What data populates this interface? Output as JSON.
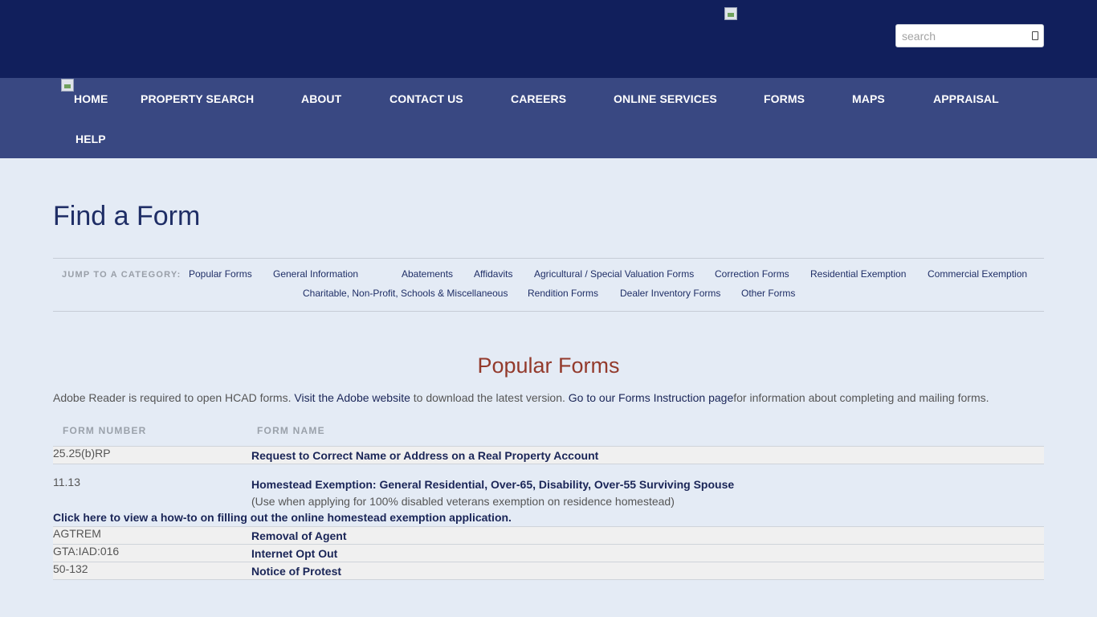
{
  "header": {
    "search_placeholder": "search"
  },
  "nav": {
    "items": [
      "HOME",
      "PROPERTY SEARCH",
      "ABOUT",
      "CONTACT US",
      "CAREERS",
      "ONLINE SERVICES",
      "FORMS",
      "MAPS",
      "APPRAISAL",
      "HELP"
    ]
  },
  "page": {
    "title": "Find a Form"
  },
  "jump": {
    "label": "JUMP TO A CATEGORY:",
    "categories": [
      "Popular Forms",
      "General Information",
      "Abatements",
      "Affidavits",
      "Agricultural / Special Valuation Forms",
      "Correction Forms",
      "Residential Exemption",
      "Commercial Exemption",
      "Charitable, Non-Profit, Schools & Miscellaneous",
      "Rendition Forms",
      "Dealer Inventory Forms",
      "Other Forms"
    ]
  },
  "popular": {
    "title": "Popular Forms",
    "intro_part1": "Adobe Reader is required to open HCAD forms. ",
    "intro_link1": "Visit the Adobe website",
    "intro_part2": " to download the latest version. ",
    "intro_link2": "Go to our Forms Instruction page",
    "intro_part3": "for information about completing and mailing forms.",
    "col_number": "FORM NUMBER",
    "col_name": "FORM NAME",
    "rows": [
      {
        "number": "25.25(b)RP",
        "name": "Request to Correct Name or Address on a Real Property Account"
      },
      {
        "number": "11.13",
        "name": "Homestead Exemption: General Residential, Over-65, Disability, Over-55 Surviving Spouse",
        "note": "(Use when applying for 100% disabled veterans exemption on residence homestead)"
      },
      {
        "number": "AGTREM",
        "name": "Removal of Agent"
      },
      {
        "number": "GTA:IAD:016",
        "name": "Internet Opt Out"
      },
      {
        "number": "50-132",
        "name": "Notice of Protest"
      }
    ],
    "howto_link": "Click here to view a how-to on filling out the online homestead exemption application."
  }
}
